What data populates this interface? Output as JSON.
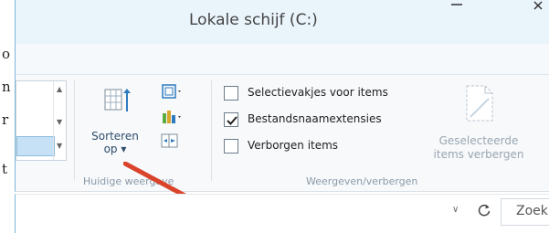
{
  "page_edge": {
    "letters": [
      "o",
      "n",
      "r",
      "t"
    ]
  },
  "window": {
    "title": "Lokale schijf (C:)"
  },
  "ribbon": {
    "layout_group": {
      "sort_button": {
        "label_line1": "Sorteren",
        "label_line2": "op ▾"
      },
      "group_label": "Huidige weergave"
    },
    "show_hide_group": {
      "checkboxes": [
        {
          "label": "Selectievakjes voor items",
          "checked": false
        },
        {
          "label": "Bestandsnaamextensies",
          "checked": true
        },
        {
          "label": "Verborgen items",
          "checked": false
        }
      ],
      "hide_button": {
        "label_line1": "Geselecteerde",
        "label_line2": "items verbergen"
      },
      "group_label": "Weergeven/verbergen"
    }
  },
  "address_bar": {
    "dropdown": "∨",
    "search_label": "Zoek"
  },
  "colors": {
    "arrow": "#d9442b",
    "accent": "#2f7bbf"
  }
}
